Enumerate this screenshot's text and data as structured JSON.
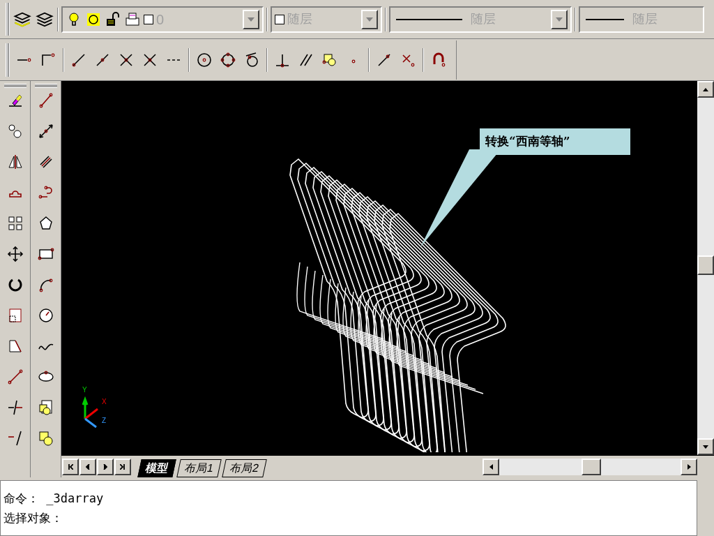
{
  "layer_toolbar": {
    "layer": "0",
    "color_setting": "随层",
    "linetype": "随层",
    "lineweight": "随层"
  },
  "callout": {
    "text": "转换“西南等轴”"
  },
  "ucs": {
    "x": "X",
    "y": "Y",
    "z": "Z"
  },
  "layout_tabs": [
    {
      "label": "模型",
      "selected": true
    },
    {
      "label": "布局1",
      "selected": false
    },
    {
      "label": "布局2",
      "selected": false
    }
  ],
  "command_lines": [
    "命令： _3darray",
    "选择对象："
  ]
}
